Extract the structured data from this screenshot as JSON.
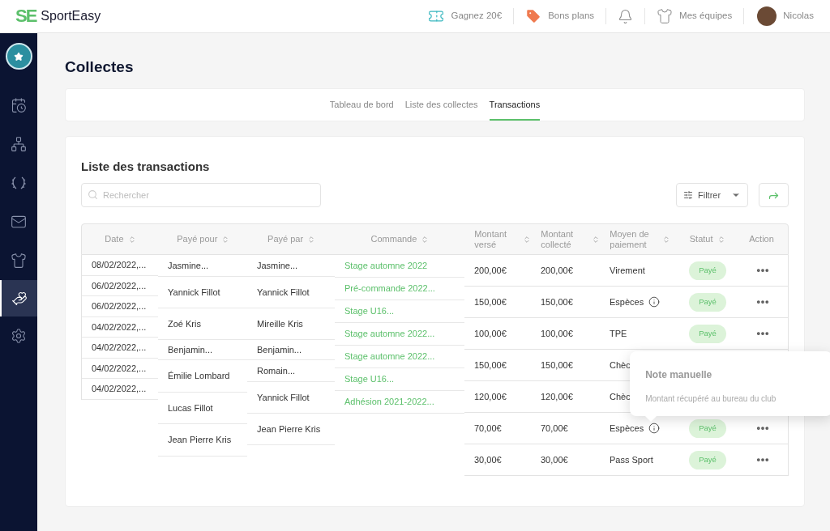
{
  "header": {
    "logo_mark": "SE",
    "brand": "SportEasy",
    "nav": [
      {
        "kind": "link",
        "label": "Gagnez 20€"
      },
      {
        "kind": "link",
        "label": "Bons plans"
      },
      {
        "kind": "icon"
      },
      {
        "kind": "link",
        "label": "Mes équipes"
      }
    ],
    "user": "Nicolas"
  },
  "sidebar": {
    "items": [
      {
        "selected": false
      },
      {
        "selected": false
      },
      {
        "selected": false
      },
      {
        "selected": false
      },
      {
        "selected": false
      },
      {
        "selected": true
      },
      {
        "selected": false
      }
    ]
  },
  "page_title": "Collectes",
  "tabs": [
    {
      "label": "Tableau de bord",
      "selected": false
    },
    {
      "label": "Liste des collectes",
      "selected": false
    },
    {
      "label": "Transactions",
      "selected": true
    }
  ],
  "panel": {
    "title": "Liste des transactions",
    "search": {
      "placeholder": "Rechercher"
    },
    "filter_button": "Filtrer"
  },
  "table": {
    "columns": [
      {
        "label": "Date",
        "sortable": true
      },
      {
        "label": "Payé pour",
        "sortable": true
      },
      {
        "label": "Payé par",
        "sortable": true
      },
      {
        "label": "Commande",
        "sortable": true
      },
      {
        "label": "Montant versé",
        "sortable": true
      },
      {
        "label": "Montant collecté",
        "sortable": true
      },
      {
        "label": "Moyen de paiement",
        "sortable": true
      },
      {
        "label": "Statut",
        "sortable": true
      },
      {
        "label": "Action",
        "sortable": false
      }
    ],
    "rows": [
      {
        "date": "08/02/2022,...",
        "paid_for": "Jasmine...",
        "paid_by": "Jasmine...",
        "order": "Stage automne 2022",
        "amount_paid": "200,00€",
        "amount_collected": "200,00€",
        "payment": "Virement",
        "note_icon": false,
        "status": "Payé"
      },
      {
        "date": "06/02/2022,...",
        "paid_for": "Yannick Fillot",
        "paid_by": "Yannick Fillot",
        "order": "Pré-commande 2022...",
        "amount_paid": "150,00€",
        "amount_collected": "150,00€",
        "payment": "Espèces",
        "note_icon": true,
        "status": "Payé"
      },
      {
        "date": "06/02/2022,...",
        "paid_for": "Zoé Kris",
        "paid_by": "Mireille Kris",
        "order": "Stage U16...",
        "amount_paid": "100,00€",
        "amount_collected": "100,00€",
        "payment": "TPE",
        "note_icon": false,
        "status": "Payé"
      },
      {
        "date": "04/02/2022,...",
        "paid_for": "Benjamin...",
        "paid_by": "Benjamin...",
        "order": "Stage automne 2022...",
        "amount_paid": "150,00€",
        "amount_collected": "150,00€",
        "payment": "Chèc",
        "note_icon": false
      },
      {
        "date": "04/02/2022,...",
        "paid_for": "Émilie Lombard",
        "paid_by": "Romain...",
        "order": "Stage automne 2022...",
        "amount_paid": "120,00€",
        "amount_collected": "120,00€",
        "payment": "Chèc",
        "note_icon": false
      },
      {
        "date": "04/02/2022,...",
        "paid_for": "Lucas Fillot",
        "paid_by": "Yannick Fillot",
        "order": "Stage U16...",
        "amount_paid": "70,00€",
        "amount_collected": "70,00€",
        "payment": "Espèces",
        "note_icon": true,
        "status": "Payé",
        "tooltip": {
          "title": "Note manuelle",
          "text": "Montant récupéré au bureau du club"
        }
      },
      {
        "date": "04/02/2022,...",
        "paid_for": "Jean Pierre Kris",
        "paid_by": "Jean Pierre Kris",
        "order": "Adhésion 2021-2022...",
        "amount_paid": "30,00€",
        "amount_collected": "30,00€",
        "payment": "Pass Sport",
        "note_icon": false,
        "status": "Payé"
      }
    ]
  }
}
